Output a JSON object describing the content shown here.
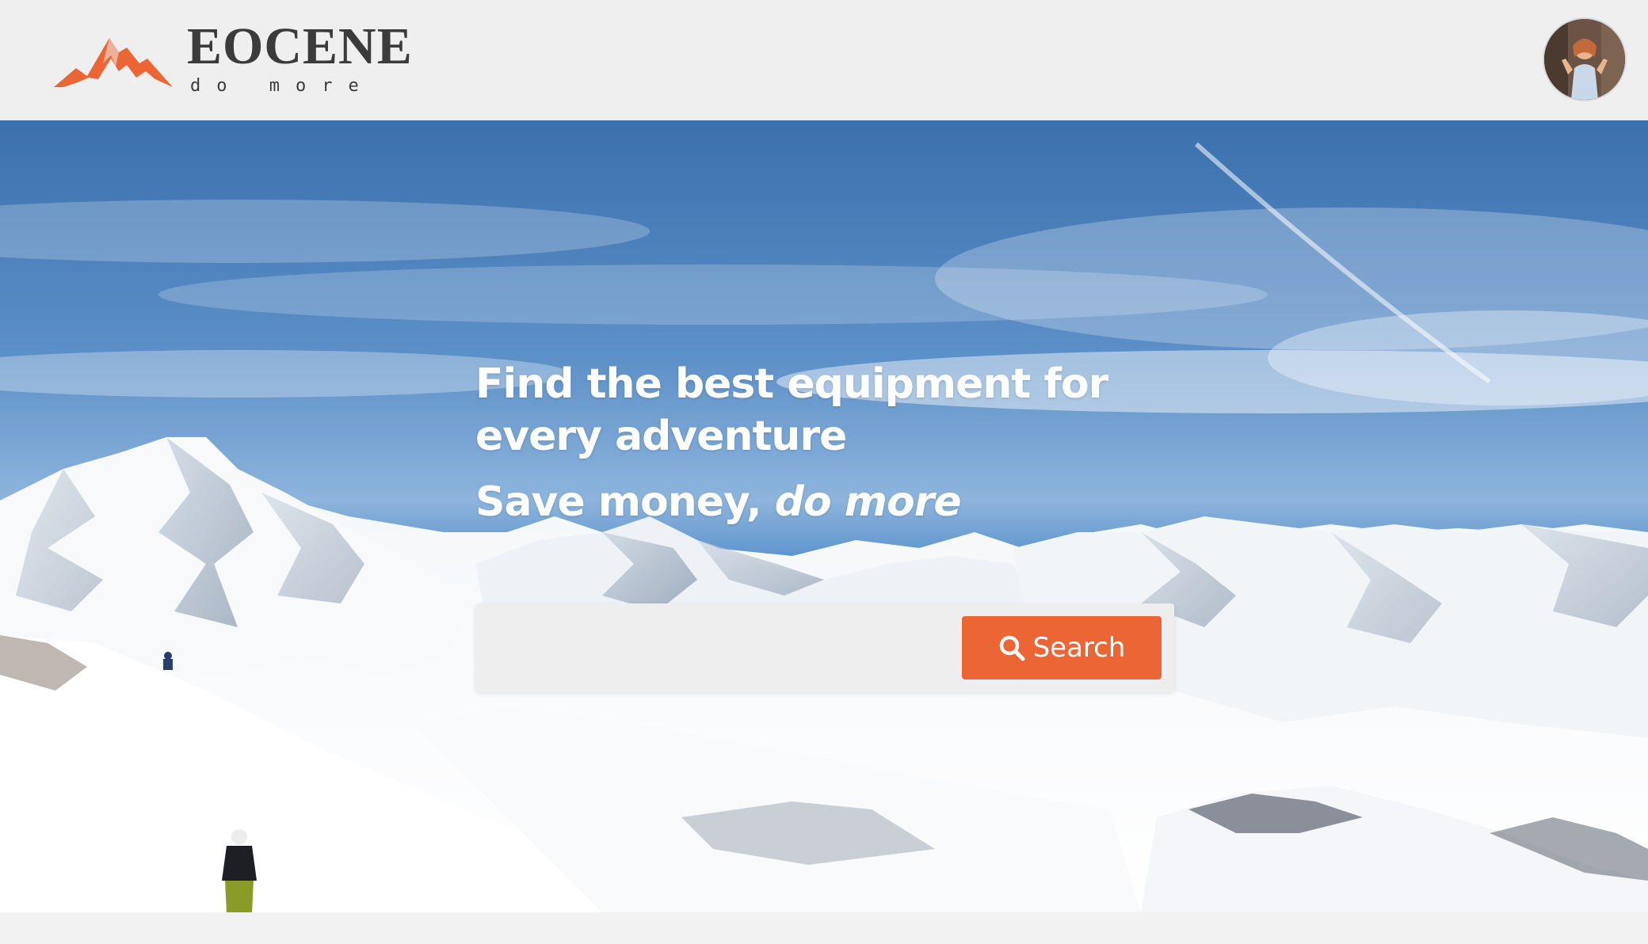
{
  "brand": {
    "name": "EOCENE",
    "tagline": "do more",
    "accent_color": "#eb6535",
    "logo_icon": "mountains-logo-icon"
  },
  "user": {
    "avatar_icon": "user-avatar"
  },
  "hero": {
    "headline": "Find the best equipment for every adventure",
    "subline_prefix": "Save money, ",
    "subline_emphasis": "do more"
  },
  "search": {
    "placeholder": "",
    "value": "",
    "button_label": "Search",
    "button_icon": "search-icon"
  }
}
